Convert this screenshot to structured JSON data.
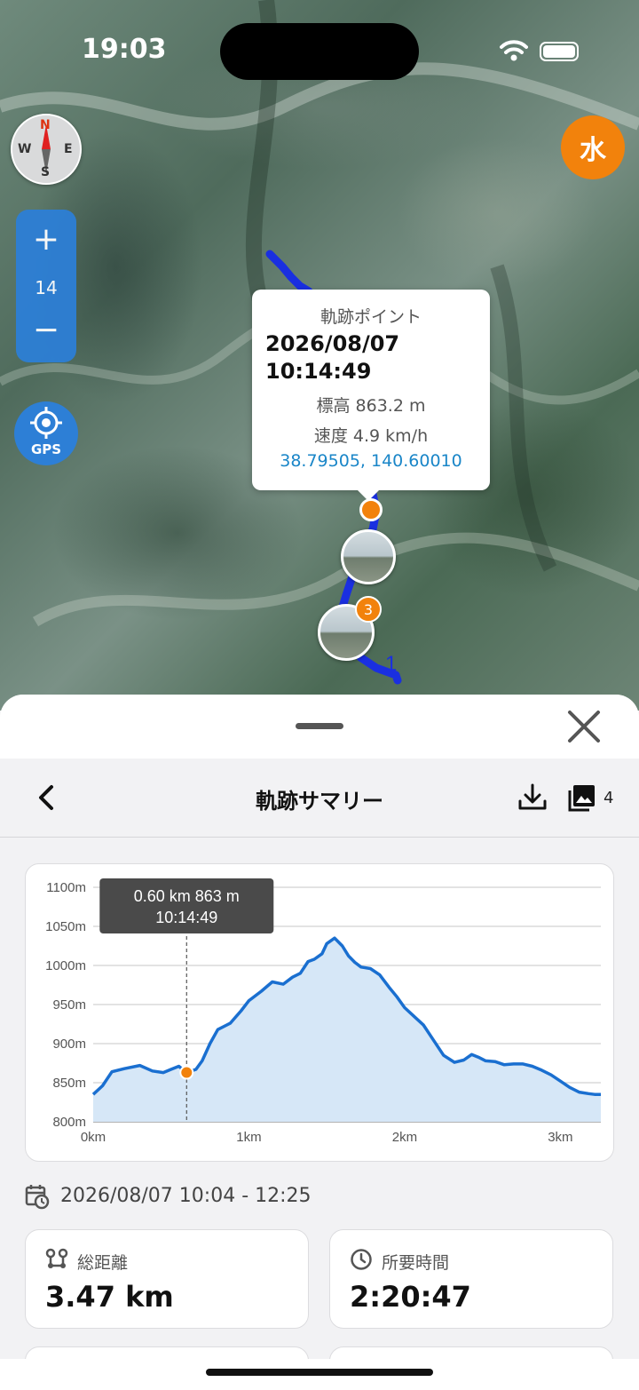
{
  "status_bar": {
    "time": "19:03"
  },
  "map": {
    "compass": {
      "n": "N",
      "e": "E",
      "s": "S",
      "w": "W"
    },
    "water_button": "水",
    "zoom": {
      "plus": "+",
      "level": "14",
      "minus": "−"
    },
    "gps_label": "GPS",
    "track_end_label": "1",
    "photo_cluster_count": "3"
  },
  "popup": {
    "title": "軌跡ポイント",
    "date": "2026/08/07",
    "time": "10:14:49",
    "elevation": "標高 863.2 m",
    "speed": "速度 4.9 km/h",
    "coordinates": "38.79505, 140.60010"
  },
  "sheet": {
    "title": "軌跡サマリー",
    "photo_count": "4",
    "date_range": "2026/08/07 10:04 - 12:25",
    "stats": [
      {
        "label": "総距離",
        "value": "3.47 km",
        "icon": "route-pin-icon"
      },
      {
        "label": "所要時間",
        "value": "2:20:47",
        "icon": "clock-icon"
      }
    ]
  },
  "colors": {
    "accent": "#1a6fd0",
    "orange": "#f2820c",
    "fill": "#d6e7f7"
  },
  "chart_data": {
    "type": "area",
    "xlabel": "",
    "ylabel": "",
    "ylim": [
      800,
      1100
    ],
    "xlim": [
      0,
      3.26
    ],
    "y_ticks": [
      "800m",
      "850m",
      "900m",
      "950m",
      "1000m",
      "1050m",
      "1100m"
    ],
    "x_ticks": [
      "0km",
      "1km",
      "2km",
      "3km"
    ],
    "grid": true,
    "series": [
      {
        "x": [
          0,
          0.06,
          0.12,
          0.2,
          0.3,
          0.38,
          0.45,
          0.5,
          0.55,
          0.6,
          0.66,
          0.7,
          0.75,
          0.8,
          0.88,
          0.95,
          1.0,
          1.08,
          1.15,
          1.22,
          1.28,
          1.33,
          1.38,
          1.42,
          1.47,
          1.5,
          1.55,
          1.6,
          1.64,
          1.68,
          1.72,
          1.78,
          1.84,
          1.9,
          1.95,
          2.0,
          2.06,
          2.12,
          2.18,
          2.25,
          2.32,
          2.38,
          2.43,
          2.48,
          2.52,
          2.58,
          2.64,
          2.7,
          2.76,
          2.82,
          2.88,
          2.94,
          3.0,
          3.06,
          3.12,
          3.18,
          3.22,
          3.26
        ],
        "values": [
          835,
          846,
          864,
          868,
          872,
          865,
          863,
          867,
          871,
          863,
          867,
          878,
          900,
          918,
          926,
          942,
          955,
          967,
          979,
          976,
          985,
          990,
          1005,
          1008,
          1015,
          1028,
          1035,
          1025,
          1012,
          1004,
          998,
          996,
          988,
          972,
          960,
          946,
          935,
          924,
          906,
          885,
          876,
          879,
          886,
          882,
          878,
          877,
          873,
          874,
          874,
          871,
          866,
          860,
          852,
          844,
          838,
          836,
          835,
          835
        ]
      }
    ],
    "marker": {
      "x": 0.6,
      "y": 863
    },
    "tooltip": {
      "line1": "0.60 km  863 m",
      "line2": "10:14:49"
    }
  }
}
